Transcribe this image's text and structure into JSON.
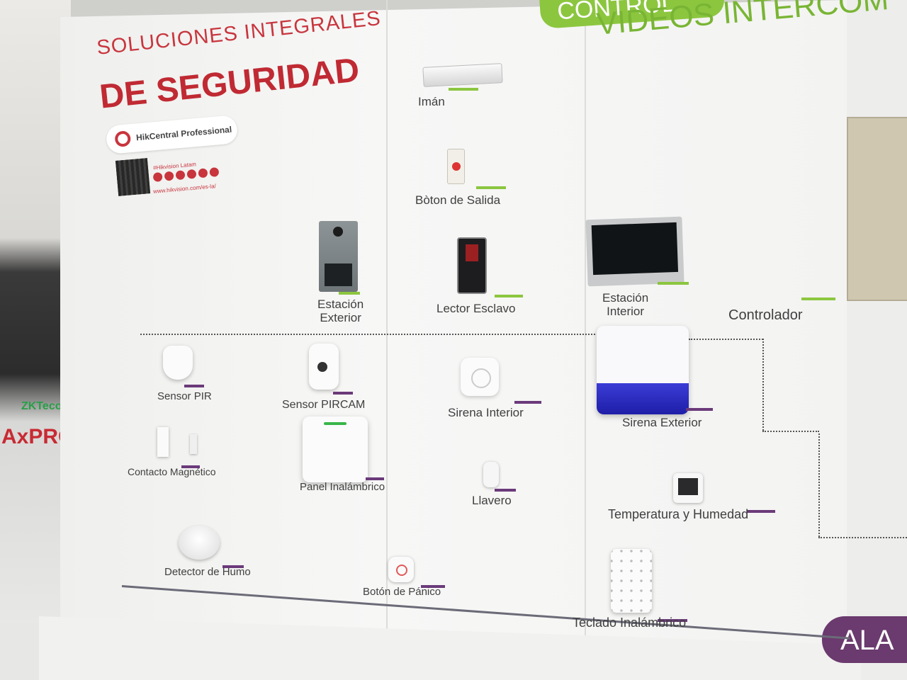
{
  "header": {
    "title_line1": "SOLUCIONES INTEGRALES",
    "title_line2": "DE SEGURIDAD",
    "badge_text": "HikCentral Professional",
    "social_handle": "#Hikvision Latam",
    "social_url": "www.hikvision.com/es-la/"
  },
  "sections": {
    "top_tab_partial": "CONTROL",
    "videos_intercom": "VIDEOS INTERCOM",
    "alarm_tab_partial": "ALA"
  },
  "background_brands": {
    "axpro": "AxPRO",
    "zkteco": "ZKTeco"
  },
  "access_control_products": [
    {
      "label": "Imán"
    },
    {
      "label": "Bòton  de Salida"
    },
    {
      "label": "Estación\nExterior"
    },
    {
      "label": "Lector Esclavo"
    },
    {
      "label": "Estación\nInterior"
    },
    {
      "label": "Controlador"
    }
  ],
  "alarm_products": [
    {
      "label": "Sensor PIR"
    },
    {
      "label": "Sensor PIRCAM"
    },
    {
      "label": "Sirena Interior"
    },
    {
      "label": "Sirena Exterior"
    },
    {
      "label": "Contacto Magnético"
    },
    {
      "label": "Panel Inalámbrico"
    },
    {
      "label": "Llavero"
    },
    {
      "label": "Temperatura y Humedad"
    },
    {
      "label": "Detector de Humo"
    },
    {
      "label": "Botón de Pánico"
    },
    {
      "label": "Teclado Inalámbrico"
    }
  ],
  "colors": {
    "brand_red": "#c02a33",
    "intercom_green": "#8cc63f",
    "alarm_purple": "#6b3a7a"
  }
}
